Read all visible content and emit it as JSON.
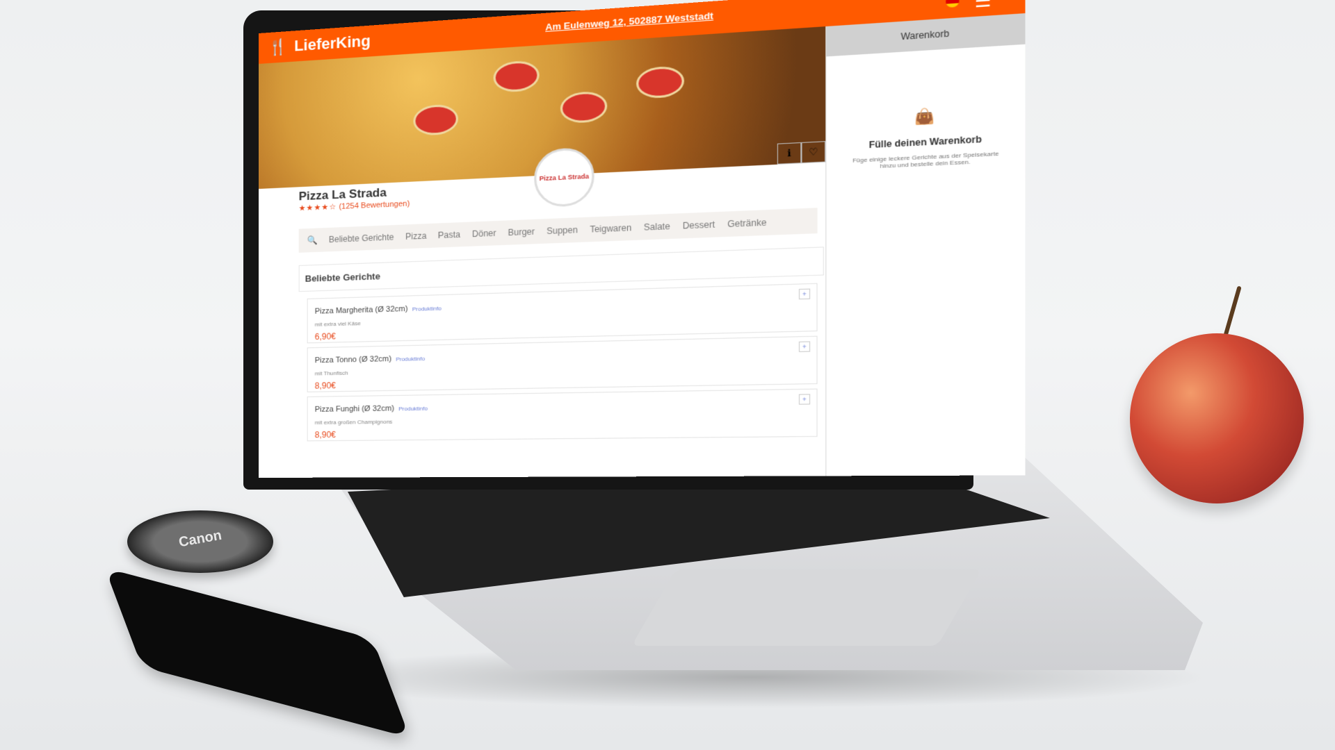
{
  "header": {
    "brand": "LieferKing",
    "address": "Am Eulenweg 12, 502887 Weststadt",
    "menu_icon": "hamburger-icon",
    "flag_icon": "germany-flag-icon"
  },
  "cart": {
    "title": "Warenkorb",
    "empty_title": "Fülle deinen Warenkorb",
    "empty_text": "Füge einige leckere Gerichte aus der Speisekarte hinzu und bestelle dein Essen."
  },
  "restaurant": {
    "name": "Pizza La Strada",
    "rating_stars": "★★★★☆",
    "reviews": "(1254 Bewertungen)",
    "logo_text": "Pizza La Strada"
  },
  "categories": [
    "Beliebte Gerichte",
    "Pizza",
    "Pasta",
    "Döner",
    "Burger",
    "Suppen",
    "Teigwaren",
    "Salate",
    "Dessert",
    "Getränke"
  ],
  "section_title": "Beliebte Gerichte",
  "items": [
    {
      "name": "Pizza Margherita (Ø 32cm)",
      "info": "Produktinfo",
      "desc": "mit extra viel Käse",
      "price": "6,90€"
    },
    {
      "name": "Pizza Tonno (Ø 32cm)",
      "info": "Produktinfo",
      "desc": "mit Thunfisch",
      "price": "8,90€"
    },
    {
      "name": "Pizza Funghi (Ø 32cm)",
      "info": "Produktinfo",
      "desc": "mit extra großen Champignons",
      "price": "8,90€"
    }
  ],
  "props": {
    "lens_cap_text": "Canon"
  },
  "colors": {
    "brand": "#ff5a00",
    "price": "#e84c1f",
    "link": "#6b7fd7"
  }
}
